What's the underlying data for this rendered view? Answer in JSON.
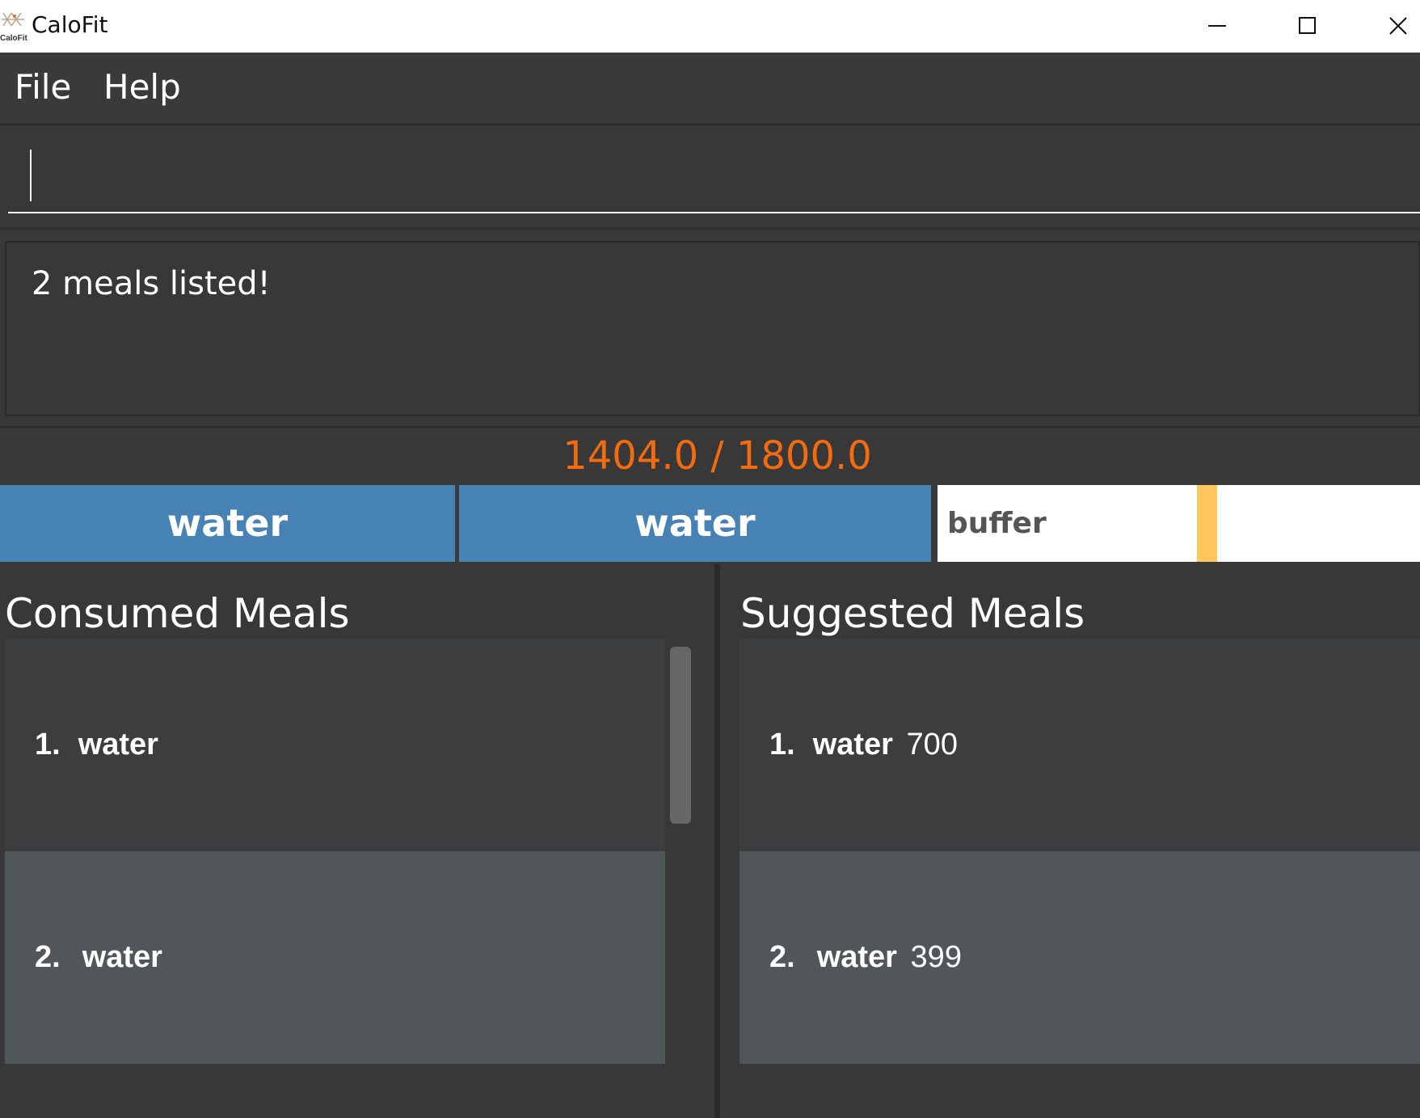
{
  "window": {
    "title": "CaloFit",
    "logo_text": "CaloFit"
  },
  "menu": {
    "file_label": "File",
    "help_label": "Help"
  },
  "command_box": {
    "value": ""
  },
  "result_display": {
    "text": "2 meals listed!"
  },
  "calorie_display": {
    "text": "1404.0 / 1800.0",
    "color": "#f26b0f"
  },
  "calorie_bar": {
    "segments": [
      {
        "label": "water",
        "color": "#4682b4"
      },
      {
        "label": "water",
        "color": "#4682b4"
      }
    ],
    "buffer_label": "buffer",
    "marker_color": "#ffc65c"
  },
  "consumed_meals": {
    "title": "Consumed Meals",
    "items": [
      {
        "index": "1.",
        "name": "water"
      },
      {
        "index": "2.",
        "name": "water"
      }
    ]
  },
  "suggested_meals": {
    "title": "Suggested Meals",
    "items": [
      {
        "index": "1.",
        "name": "water",
        "calories": "700"
      },
      {
        "index": "2.",
        "name": "water",
        "calories": "399"
      }
    ]
  }
}
